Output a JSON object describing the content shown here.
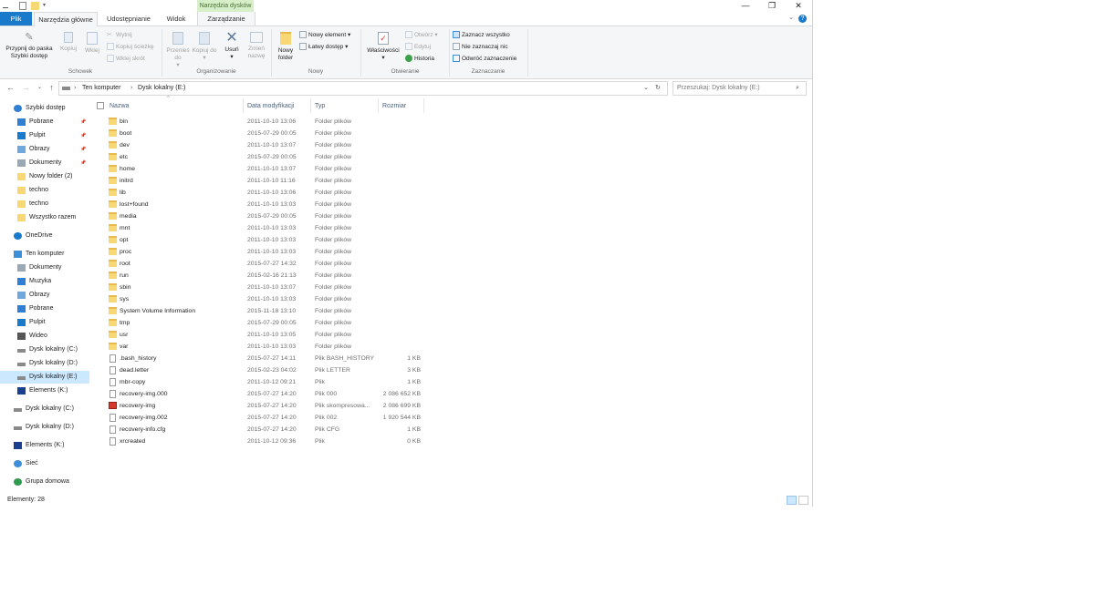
{
  "quick_access_toolbar": {
    "icons": [
      "properties-icon",
      "new-folder-icon"
    ]
  },
  "window_controls": {
    "minimize": "—",
    "maximize": "❐",
    "close": "✕"
  },
  "context_tab": {
    "label": "Narzędzia dysków"
  },
  "ribbon_tabs": [
    {
      "label": "Plik"
    },
    {
      "label": "Narzędzia główne"
    },
    {
      "label": "Udostępnianie"
    },
    {
      "label": "Widok"
    },
    {
      "label": "Zarządzanie"
    }
  ],
  "ribbon": {
    "schowek": {
      "label": "Schowek",
      "pin": "Przypnij do paska Szybki dostęp",
      "copy": "Kopiuj",
      "paste": "Wklej",
      "cut": "Wytnij",
      "copy_path": "Kopiuj ścieżkę",
      "paste_shortcut": "Wklej skrót"
    },
    "organizowanie": {
      "label": "Organizowanie",
      "move_to": "Przenieś do",
      "copy_to": "Kopiuj do",
      "delete": "Usuń",
      "rename": "Zmień nazwę"
    },
    "nowy": {
      "label": "Nowy",
      "new_folder": "Nowy folder",
      "new_item": "Nowy element",
      "easy_access": "Łatwy dostęp"
    },
    "otwieranie": {
      "label": "Otwieranie",
      "properties": "Właściwości",
      "open": "Otwórz",
      "edit": "Edytuj",
      "history": "Historia"
    },
    "zaznaczanie": {
      "label": "Zaznaczanie",
      "select_all": "Zaznacz wszystko",
      "select_none": "Nie zaznaczaj nic",
      "invert": "Odwróć zaznaczenie"
    }
  },
  "address": {
    "crumbs": [
      "Ten komputer",
      "Dysk lokalny (E:)"
    ],
    "search_placeholder": "Przeszukaj: Dysk lokalny (E:)"
  },
  "nav": [
    {
      "label": "Szybki dostęp",
      "icon": "star-icon",
      "indent": 0,
      "color": "#2f7fd3"
    },
    {
      "label": "Pobrane",
      "icon": "download-icon",
      "indent": 1,
      "pinned": true,
      "color": "#2f7fd3"
    },
    {
      "label": "Pulpit",
      "icon": "desktop-icon",
      "indent": 1,
      "pinned": true,
      "color": "#1979ca"
    },
    {
      "label": "Obrazy",
      "icon": "pictures-icon",
      "indent": 1,
      "pinned": true,
      "color": "#6fa8dc"
    },
    {
      "label": "Dokumenty",
      "icon": "documents-icon",
      "indent": 1,
      "pinned": true,
      "color": "#9aa7b5"
    },
    {
      "label": "Nowy folder (2)",
      "icon": "folder-icon",
      "indent": 1,
      "color": "#f8d775"
    },
    {
      "label": "techno",
      "icon": "folder-icon",
      "indent": 1,
      "color": "#f8d775"
    },
    {
      "label": "techno",
      "icon": "folder-icon",
      "indent": 1,
      "color": "#f8d775"
    },
    {
      "label": "Wszystko razem",
      "icon": "folder-icon",
      "indent": 1,
      "color": "#f8d775"
    },
    {
      "label": "OneDrive",
      "icon": "cloud-icon",
      "indent": 0,
      "color": "#1979ca",
      "gap": true
    },
    {
      "label": "Ten komputer",
      "icon": "computer-icon",
      "indent": 0,
      "color": "#3c8fd8",
      "gap": true
    },
    {
      "label": "Dokumenty",
      "icon": "documents-icon",
      "indent": 1,
      "color": "#9aa7b5"
    },
    {
      "label": "Muzyka",
      "icon": "music-icon",
      "indent": 1,
      "color": "#2f7fd3"
    },
    {
      "label": "Obrazy",
      "icon": "pictures-icon",
      "indent": 1,
      "color": "#6fa8dc"
    },
    {
      "label": "Pobrane",
      "icon": "download-icon",
      "indent": 1,
      "color": "#2f7fd3"
    },
    {
      "label": "Pulpit",
      "icon": "desktop-icon",
      "indent": 1,
      "color": "#1979ca"
    },
    {
      "label": "Wideo",
      "icon": "video-icon",
      "indent": 1,
      "color": "#555555"
    },
    {
      "label": "Dysk lokalny (C:)",
      "icon": "drive-icon",
      "indent": 1,
      "color": "#8a8a8a"
    },
    {
      "label": "Dysk lokalny (D:)",
      "icon": "drive-icon",
      "indent": 1,
      "color": "#8a8a8a"
    },
    {
      "label": "Dysk lokalny (E:)",
      "icon": "drive-icon",
      "indent": 1,
      "color": "#8a8a8a",
      "selected": true
    },
    {
      "label": "Elements (K:)",
      "icon": "usb-drive-icon",
      "indent": 1,
      "color": "#1b3f8f"
    },
    {
      "label": "Dysk lokalny (C:)",
      "icon": "drive-icon",
      "indent": 0,
      "color": "#8a8a8a",
      "gap": true
    },
    {
      "label": "Dysk lokalny (D:)",
      "icon": "drive-icon",
      "indent": 0,
      "color": "#8a8a8a",
      "gap": true
    },
    {
      "label": "Elements (K:)",
      "icon": "usb-drive-icon",
      "indent": 0,
      "color": "#1b3f8f",
      "gap": true
    },
    {
      "label": "Sieć",
      "icon": "network-icon",
      "indent": 0,
      "color": "#3c8fd8",
      "gap": true
    },
    {
      "label": "Grupa domowa",
      "icon": "homegroup-icon",
      "indent": 0,
      "color": "#2f9a4e",
      "gap": true
    }
  ],
  "columns": {
    "name": "Nazwa",
    "date": "Data modyfikacji",
    "type": "Typ",
    "size": "Rozmiar"
  },
  "files": [
    {
      "name": "bin",
      "date": "2011-10-10 13:06",
      "type": "Folder plików",
      "size": "",
      "kind": "folder"
    },
    {
      "name": "boot",
      "date": "2015-07-29 00:05",
      "type": "Folder plików",
      "size": "",
      "kind": "folder"
    },
    {
      "name": "dev",
      "date": "2011-10-10 13:07",
      "type": "Folder plików",
      "size": "",
      "kind": "folder"
    },
    {
      "name": "etc",
      "date": "2015-07-29 00:05",
      "type": "Folder plików",
      "size": "",
      "kind": "folder"
    },
    {
      "name": "home",
      "date": "2011-10-10 13:07",
      "type": "Folder plików",
      "size": "",
      "kind": "folder"
    },
    {
      "name": "initrd",
      "date": "2011-10-10 11:16",
      "type": "Folder plików",
      "size": "",
      "kind": "folder"
    },
    {
      "name": "lib",
      "date": "2011-10-10 13:06",
      "type": "Folder plików",
      "size": "",
      "kind": "folder"
    },
    {
      "name": "lost+found",
      "date": "2011-10-10 13:03",
      "type": "Folder plików",
      "size": "",
      "kind": "folder"
    },
    {
      "name": "media",
      "date": "2015-07-29 00:05",
      "type": "Folder plików",
      "size": "",
      "kind": "folder"
    },
    {
      "name": "mnt",
      "date": "2011-10-10 13:03",
      "type": "Folder plików",
      "size": "",
      "kind": "folder"
    },
    {
      "name": "opt",
      "date": "2011-10-10 13:03",
      "type": "Folder plików",
      "size": "",
      "kind": "folder"
    },
    {
      "name": "proc",
      "date": "2011-10-10 13:03",
      "type": "Folder plików",
      "size": "",
      "kind": "folder"
    },
    {
      "name": "root",
      "date": "2015-07-27 14:32",
      "type": "Folder plików",
      "size": "",
      "kind": "folder"
    },
    {
      "name": "run",
      "date": "2015-02-16 21:13",
      "type": "Folder plików",
      "size": "",
      "kind": "folder"
    },
    {
      "name": "sbin",
      "date": "2011-10-10 13:07",
      "type": "Folder plików",
      "size": "",
      "kind": "folder"
    },
    {
      "name": "sys",
      "date": "2011-10-10 13:03",
      "type": "Folder plików",
      "size": "",
      "kind": "folder"
    },
    {
      "name": "System Volume Information",
      "date": "2015-11-18 13:10",
      "type": "Folder plików",
      "size": "",
      "kind": "folder"
    },
    {
      "name": "tmp",
      "date": "2015-07-29 00:05",
      "type": "Folder plików",
      "size": "",
      "kind": "folder"
    },
    {
      "name": "usr",
      "date": "2011-10-10 13:05",
      "type": "Folder plików",
      "size": "",
      "kind": "folder"
    },
    {
      "name": "var",
      "date": "2011-10-10 13:03",
      "type": "Folder plików",
      "size": "",
      "kind": "folder"
    },
    {
      "name": ".bash_history",
      "date": "2015-07-27 14:11",
      "type": "Plik BASH_HISTORY",
      "size": "1 KB",
      "kind": "doc"
    },
    {
      "name": "dead.letter",
      "date": "2015-02-23 04:02",
      "type": "Plik LETTER",
      "size": "3 KB",
      "kind": "doc"
    },
    {
      "name": "mbr-copy",
      "date": "2011-10-12 09:21",
      "type": "Plik",
      "size": "1 KB",
      "kind": "doc"
    },
    {
      "name": "recovery-img.000",
      "date": "2015-07-27 14:20",
      "type": "Plik 000",
      "size": "2 086 652 KB",
      "kind": "doc"
    },
    {
      "name": "recovery-img",
      "date": "2015-07-27 14:20",
      "type": "Plik skompresowa...",
      "size": "2 086 699 KB",
      "kind": "archive"
    },
    {
      "name": "recovery-img.002",
      "date": "2015-07-27 14:20",
      "type": "Plik 002",
      "size": "1 920 544 KB",
      "kind": "doc"
    },
    {
      "name": "recovery-info.cfg",
      "date": "2015-07-27 14:20",
      "type": "Plik CFG",
      "size": "1 KB",
      "kind": "doc"
    },
    {
      "name": "xrcreated",
      "date": "2011-10-12 09:36",
      "type": "Plik",
      "size": "0 KB",
      "kind": "doc"
    }
  ],
  "status": {
    "items_count": "Elementy: 28"
  }
}
